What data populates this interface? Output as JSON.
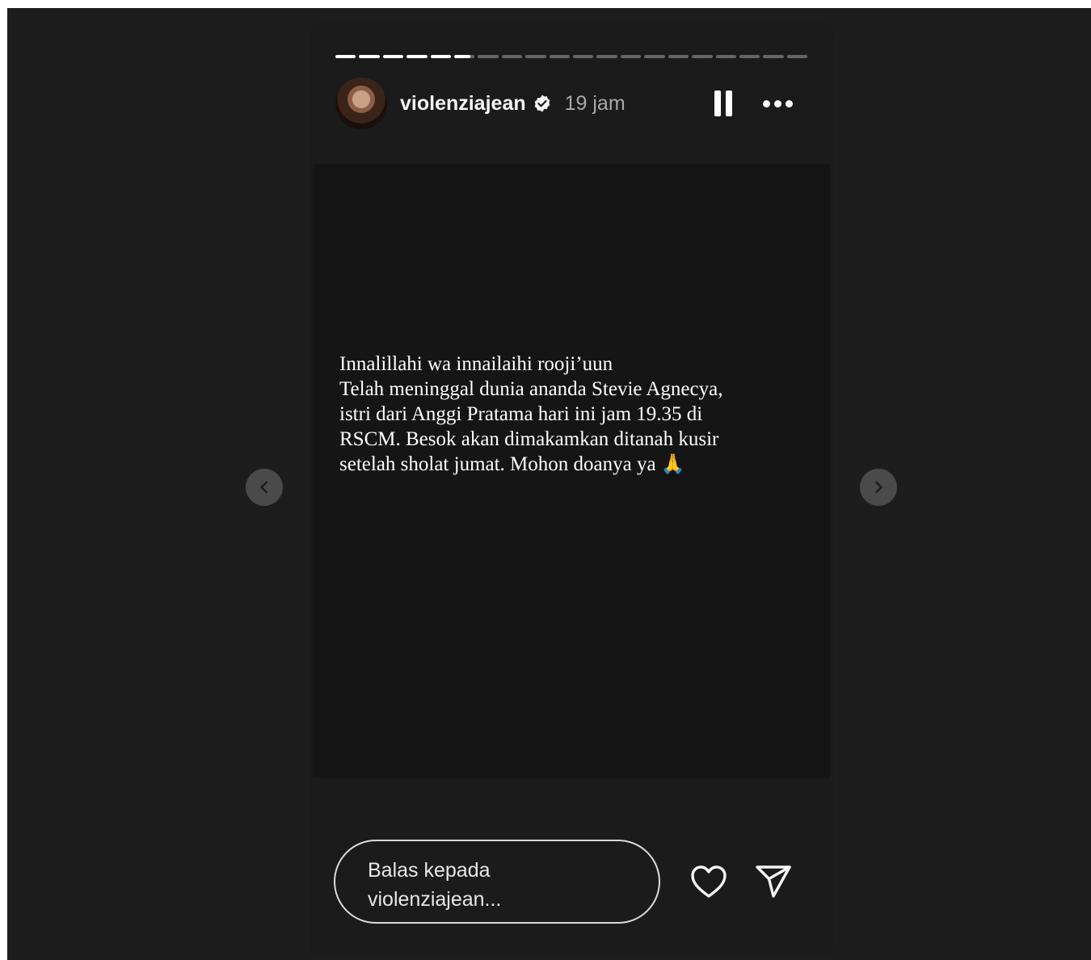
{
  "story": {
    "progress_fractions": [
      1,
      1,
      1,
      1,
      1,
      0.8,
      0,
      0,
      0,
      0,
      0,
      0,
      0,
      0,
      0,
      0,
      0,
      0,
      0,
      0
    ],
    "username": "violenziajean",
    "time_ago": "19 jam",
    "verified_icon": "verified-badge-icon",
    "text_lines": [
      "Innalillahi wa innailaihi rooji’uun",
      "Telah meninggal dunia ananda Stevie Agnecya,",
      "istri dari Anggi Pratama hari ini jam 19.35 di",
      "RSCM.  Besok akan dimakamkan ditanah kusir",
      "setelah sholat jumat. Mohon doanya ya"
    ],
    "emoji": "🙏"
  },
  "footer": {
    "reply_line1": "Balas kepada",
    "reply_line2": "violenziajean...",
    "like_icon": "heart-icon",
    "share_icon": "send-icon"
  },
  "nav": {
    "prev_icon": "chevron-left-icon",
    "next_icon": "chevron-right-icon"
  },
  "colors": {
    "background": "#1d1d1d",
    "card": "#1b1b1b",
    "text": "#ffffff",
    "muted": "#a8a8a8"
  }
}
